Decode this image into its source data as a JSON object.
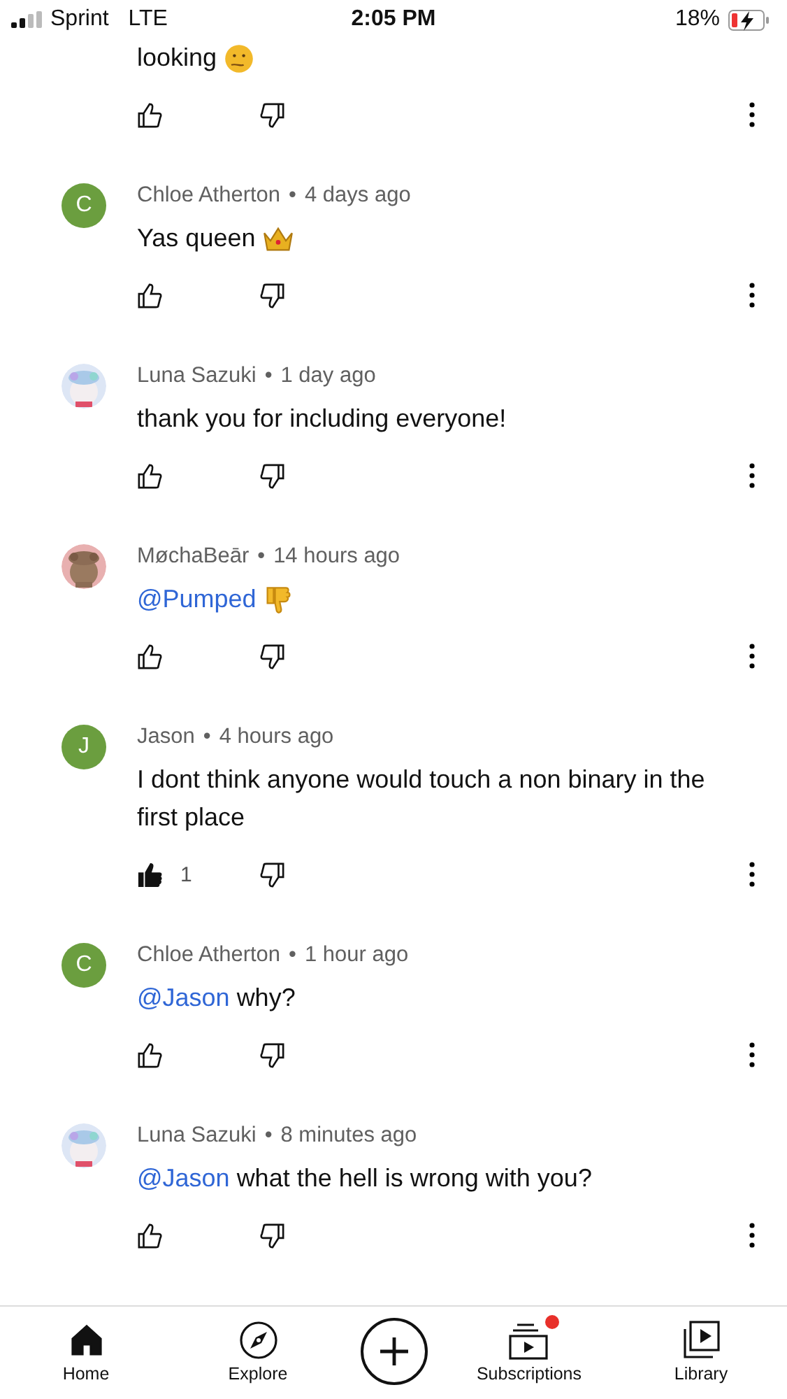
{
  "status_bar": {
    "carrier": "Sprint",
    "network": "LTE",
    "time": "2:05 PM",
    "battery": "18%",
    "charging": true
  },
  "partial_comment": {
    "text": "looking",
    "emoji": {
      "kind": "thinking"
    },
    "liked": false
  },
  "comments": [
    {
      "author": "Chloe Atherton",
      "separator": "•",
      "time": "4 days ago",
      "avatar": {
        "kind": "letter",
        "letter": "C",
        "color": "#6b9e3f"
      },
      "text": "Yas queen",
      "emoji": {
        "kind": "crown"
      },
      "liked": false
    },
    {
      "author": "Luna Sazuki",
      "separator": "•",
      "time": "1 day ago",
      "text": "thank you for including everyone!",
      "liked": false
    },
    {
      "author": "MøchaBeār",
      "separator": "•",
      "time": "14 hours ago",
      "mention": "@Pumped",
      "emoji": {
        "kind": "thumbs-down"
      },
      "liked": false
    },
    {
      "author": "Jason",
      "separator": "•",
      "time": "4 hours ago",
      "avatar": {
        "kind": "letter",
        "letter": "J",
        "color": "#6b9e3f"
      },
      "text": "I dont think anyone would touch a non binary in the first place",
      "liked": true,
      "like_count": "1"
    },
    {
      "author": "Chloe Atherton",
      "separator": "•",
      "time": "1 hour ago",
      "avatar": {
        "kind": "letter",
        "letter": "C",
        "color": "#6b9e3f"
      },
      "mention": "@Jason",
      "text": "why?",
      "liked": false
    },
    {
      "author": "Luna Sazuki",
      "separator": "•",
      "time": "8 minutes ago",
      "mention": "@Jason",
      "text": "what the hell is wrong with you?",
      "liked": false
    }
  ],
  "nav": [
    {
      "kind": "home",
      "label": "Home",
      "selected": true
    },
    {
      "kind": "explore",
      "label": "Explore",
      "selected": false
    },
    {
      "kind": "create"
    },
    {
      "kind": "subscriptions",
      "label": "Subscriptions",
      "selected": false,
      "notification": true
    },
    {
      "kind": "library",
      "label": "Library",
      "selected": false
    }
  ]
}
